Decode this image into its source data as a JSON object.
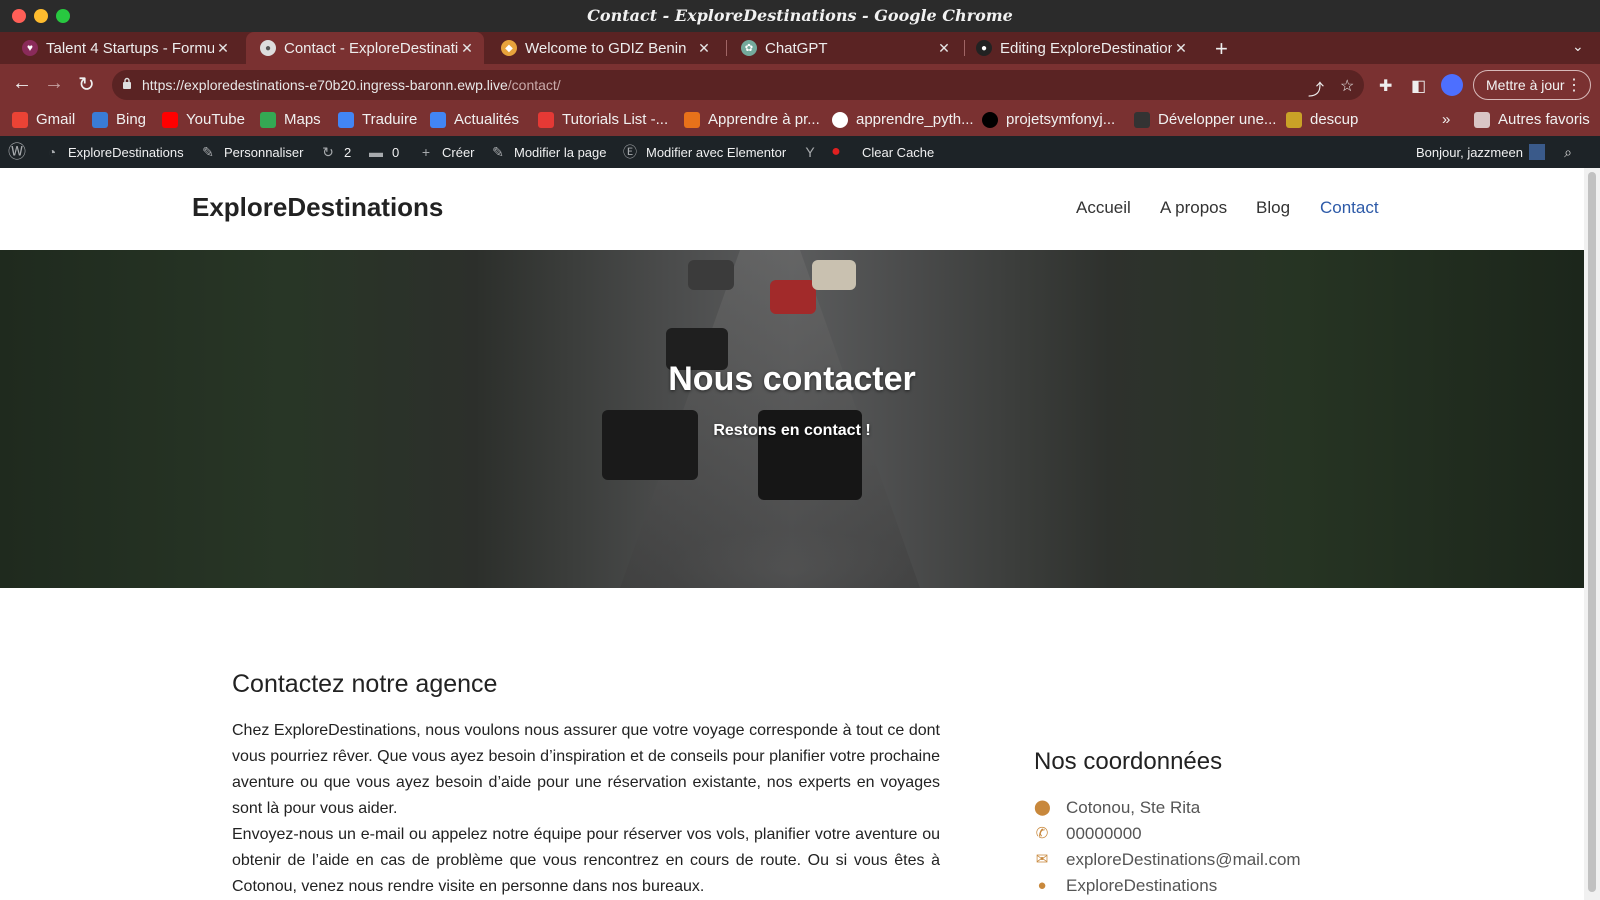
{
  "window": {
    "title": "Contact - ExploreDestinations - Google Chrome"
  },
  "tabs": [
    {
      "label": "Talent 4 Startups - Formul",
      "icon": "heart-icon",
      "active": false
    },
    {
      "label": "Contact - ExploreDestinati",
      "icon": "globe-icon",
      "active": true
    },
    {
      "label": "Welcome to GDIZ Benin",
      "icon": "gdiz-icon",
      "active": false
    },
    {
      "label": "ChatGPT",
      "icon": "chatgpt-icon",
      "active": false
    },
    {
      "label": "Editing ExploreDestination",
      "icon": "github-icon",
      "active": false
    }
  ],
  "toolbar": {
    "url_host": "https://exploredestinations-e70b20.ingress-baronn.ewp.live",
    "url_path": "/contact/",
    "update_label": "Mettre à jour"
  },
  "bookmarks": [
    {
      "label": "Gmail",
      "color": "#ea4335"
    },
    {
      "label": "Bing",
      "color": "#3a7bd5"
    },
    {
      "label": "YouTube",
      "color": "#ff0000"
    },
    {
      "label": "Maps",
      "color": "#34a853"
    },
    {
      "label": "Traduire",
      "color": "#4285f4"
    },
    {
      "label": "Actualités",
      "color": "#4285f4"
    },
    {
      "label": "Tutorials List -...",
      "color": "#e53935"
    },
    {
      "label": "Apprendre à pr...",
      "color": "#e8711a"
    },
    {
      "label": "apprendre_pyth...",
      "color": "#ffffff"
    },
    {
      "label": "projetsymfonyj...",
      "color": "#000000"
    },
    {
      "label": "Développer une...",
      "color": "#333333"
    },
    {
      "label": "descup",
      "color": "#c9a227"
    }
  ],
  "bookmarks_other": "Autres favoris",
  "wp_admin": {
    "site": "ExploreDestinations",
    "customize": "Personnaliser",
    "updates": "2",
    "comments": "0",
    "new": "Créer",
    "edit_page": "Modifier la page",
    "elementor": "Modifier avec Elementor",
    "clear_cache": "Clear Cache",
    "greeting": "Bonjour, jazzmeen"
  },
  "site": {
    "title": "ExploreDestinations",
    "nav": [
      "Accueil",
      "A propos",
      "Blog",
      "Contact"
    ],
    "active_nav": "Contact"
  },
  "hero": {
    "title": "Nous contacter",
    "subtitle": "Restons en contact !"
  },
  "content": {
    "heading": "Contactez notre agence",
    "para1": "Chez ExploreDestinations, nous voulons nous assurer que votre voyage corresponde à tout ce dont vous pourriez rêver. Que vous ayez besoin d’inspiration et de conseils pour planifier votre prochaine aventure ou que vous ayez besoin d’aide pour une réservation existante, nos experts en voyages sont là pour vous aider.",
    "para2": "Envoyez-nous un e-mail ou appelez notre équipe pour réserver vos vols, planifier votre aventure ou obtenir de l’aide en cas de problème que vous rencontrez en cours de route. Ou si vous êtes à Cotonou, venez nous rendre visite en personne dans nos bureaux."
  },
  "contact": {
    "heading": "Nos coordonnées",
    "address": "Cotonou, Ste Rita",
    "phone": "00000000",
    "email": "exploreDestinations@mail.com",
    "name": "ExploreDestinations"
  },
  "colors": {
    "tab_strip": "#5a2323",
    "toolbar": "#7a3131",
    "wp_bar": "#1d2327",
    "nav_active": "#2d5aa8",
    "contact_icon": "#c8883c"
  }
}
